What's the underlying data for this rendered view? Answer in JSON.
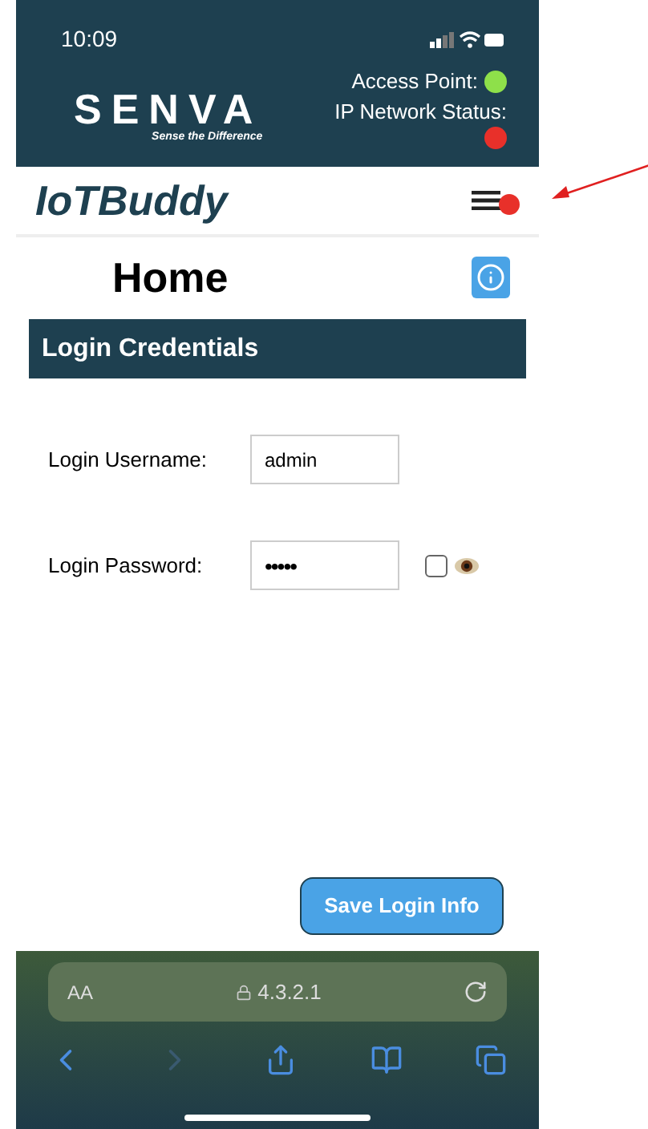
{
  "status_bar": {
    "time": "10:09"
  },
  "header": {
    "logo": "SENVA",
    "tagline": "Sense the Difference",
    "indicators": [
      {
        "label": "Access Point:",
        "color": "#8ee04a"
      },
      {
        "label": "IP Network Status:",
        "color": "#e8302a"
      }
    ]
  },
  "nav": {
    "brand": "IoTBuddy",
    "menu_badge": true
  },
  "page": {
    "title": "Home"
  },
  "section": {
    "title": "Login Credentials"
  },
  "fields": [
    {
      "label": "Login Username:",
      "value": "admin",
      "kind": "text"
    },
    {
      "label": "Login Password:",
      "value": "•••••",
      "kind": "password",
      "show_checked": false
    }
  ],
  "save_button": "Save Login Info",
  "browser": {
    "text_size": "AA",
    "address": "4.3.2.1"
  }
}
